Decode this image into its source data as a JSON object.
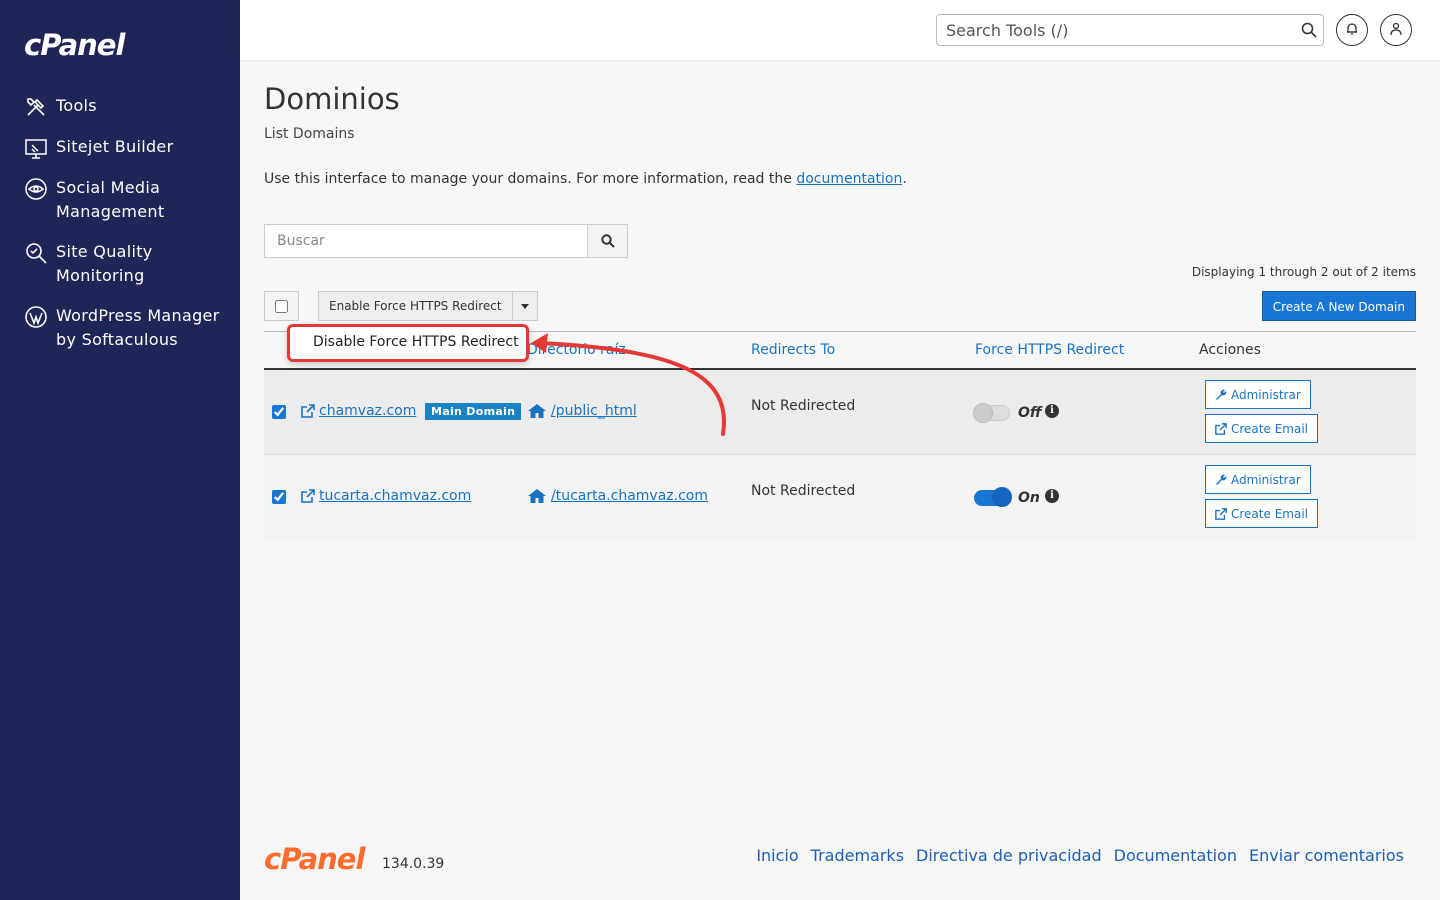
{
  "brand": {
    "logo": "cPanel",
    "version": "134.0.39"
  },
  "sidebar": {
    "items": [
      {
        "label": "Tools",
        "icon": "tools-icon"
      },
      {
        "label": "Sitejet Builder",
        "icon": "sitejet-icon"
      },
      {
        "label": "Social Media Management",
        "icon": "social-media-icon"
      },
      {
        "label": "Site Quality Monitoring",
        "icon": "site-quality-icon"
      },
      {
        "label": "WordPress Manager by Softaculous",
        "icon": "wordpress-icon"
      }
    ]
  },
  "header": {
    "search_placeholder": "Search Tools (/)"
  },
  "page": {
    "title": "Dominios",
    "subtitle": "List Domains",
    "intro_text": "Use this interface to manage your domains. For more information, read the ",
    "intro_link": "documentation",
    "intro_end": ".",
    "search_placeholder": "Buscar",
    "displaying": "Displaying 1 through 2 out of 2 items",
    "bulk_action": "Enable Force HTTPS Redirect",
    "create_button": "Create A New Domain",
    "dropdown_item": "Disable Force HTTPS Redirect"
  },
  "table": {
    "headers": {
      "docroot": "Directorio raíz",
      "redirects": "Redirects To",
      "https": "Force HTTPS Redirect",
      "actions": "Acciones"
    },
    "rows": [
      {
        "domain": "chamvaz.com",
        "badge": "Main Domain",
        "docroot": "/public_html",
        "redirect": "Not Redirected",
        "https_state": "Off",
        "https_on": false,
        "manage": "Administrar",
        "email": "Create Email",
        "checked": true
      },
      {
        "domain": "tucarta.chamvaz.com",
        "badge": "",
        "docroot": "/tucarta.chamvaz.com",
        "redirect": "Not Redirected",
        "https_state": "On",
        "https_on": true,
        "manage": "Administrar",
        "email": "Create Email",
        "checked": true
      }
    ]
  },
  "footer": {
    "links": [
      "Inicio",
      "Trademarks",
      "Directiva de privacidad",
      "Documentation",
      "Enviar comentarios"
    ]
  },
  "colors": {
    "sidebar_bg": "#1f2657",
    "accent": "#1976d2",
    "highlight": "#e53935",
    "footer_logo": "#ff6c2c"
  }
}
